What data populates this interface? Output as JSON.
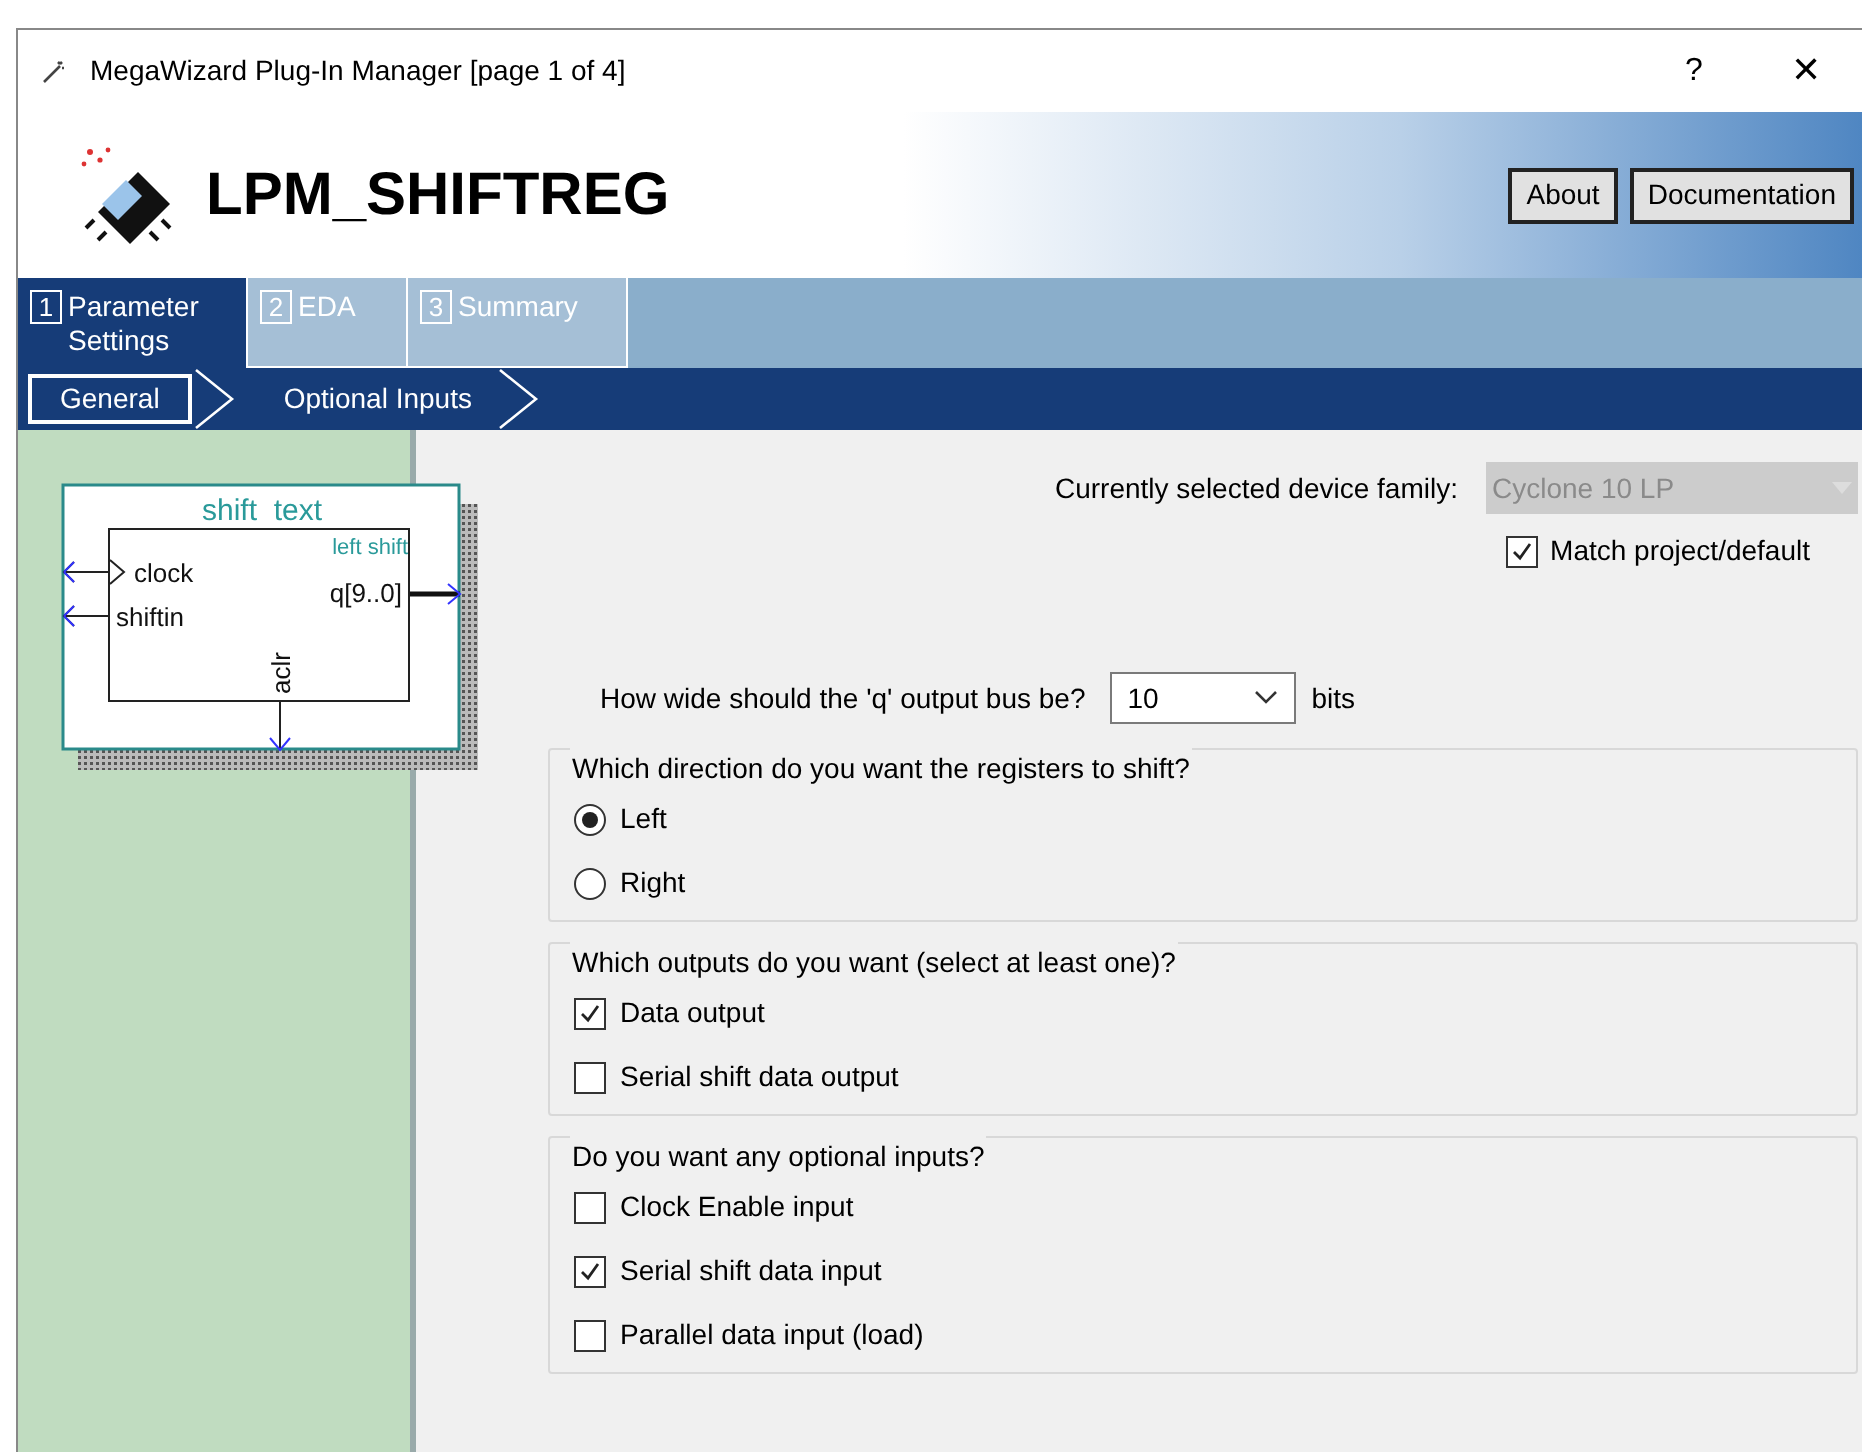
{
  "window": {
    "title": "MegaWizard Plug-In Manager [page 1 of 4]",
    "help": "?",
    "close": "✕"
  },
  "header": {
    "title": "LPM_SHIFTREG",
    "buttons": [
      "About",
      "Documentation"
    ]
  },
  "steps": [
    {
      "number": "1",
      "label": "Parameter Settings",
      "selected": true
    },
    {
      "number": "2",
      "label": "EDA",
      "selected": false
    },
    {
      "number": "3",
      "label": "Summary",
      "selected": false
    }
  ],
  "breadcrumbs": [
    {
      "label": "General",
      "selected": true
    },
    {
      "label": "Optional Inputs",
      "selected": false
    }
  ],
  "diagram": {
    "title": "shift  text",
    "mode": "left shift",
    "inputs": [
      {
        "name": "clock",
        "kind": "clock"
      },
      {
        "name": "shiftin",
        "kind": "data"
      }
    ],
    "output": "q[9..0]",
    "bottom_input": "aclr"
  },
  "device": {
    "label": "Currently selected device family:",
    "value": "Cyclone 10 LP",
    "disabled": true,
    "match": {
      "label": "Match project/default",
      "checked": true
    }
  },
  "bus_width": {
    "label": "How wide should the 'q' output bus be?",
    "value": "10",
    "unit": "bits"
  },
  "groups": [
    {
      "title": "Which direction do you want the registers to shift?",
      "options": [
        {
          "kind": "radio",
          "label": "Left",
          "selected": true
        },
        {
          "kind": "radio",
          "label": "Right",
          "selected": false
        }
      ]
    },
    {
      "title": "Which outputs do you want (select at least one)?",
      "options": [
        {
          "kind": "checkbox",
          "label": "Data output",
          "checked": true
        },
        {
          "kind": "checkbox",
          "label": "Serial shift data output",
          "checked": false
        }
      ]
    },
    {
      "title": "Do you want any optional inputs?",
      "options": [
        {
          "kind": "checkbox",
          "label": "Clock Enable input",
          "checked": false
        },
        {
          "kind": "checkbox",
          "label": "Serial shift data input",
          "checked": true
        },
        {
          "kind": "checkbox",
          "label": "Parallel data input (load)",
          "checked": false
        }
      ]
    }
  ]
}
